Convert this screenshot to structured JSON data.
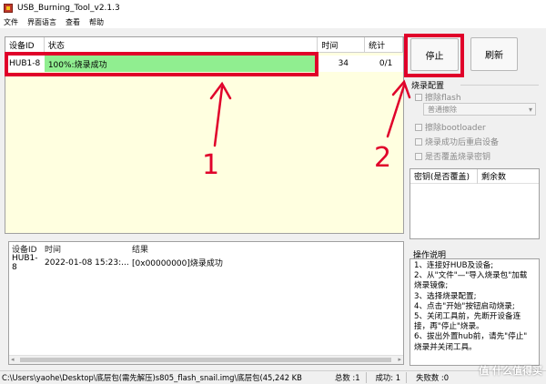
{
  "window": {
    "title": "USB_Burning_Tool_v2.1.3"
  },
  "menu": [
    "文件",
    "界面语言",
    "查看",
    "帮助"
  ],
  "table": {
    "headers": [
      "设备ID",
      "状态",
      "时间",
      "统计"
    ],
    "row": {
      "id": "HUB1-8",
      "status": "100%:烧录成功",
      "time": "34",
      "count": "0/1"
    }
  },
  "buttons": {
    "stop": "停止",
    "refresh": "刷新"
  },
  "config": {
    "title": "烧录配置",
    "erase_flash": "擦除flash",
    "erase_mode": "普通擦除",
    "erase_bootloader": "擦除bootloader",
    "reboot_after": "烧录成功后重启设备",
    "overwrite_key": "是否覆盖烧录密钥"
  },
  "key_table": {
    "col1": "密钥(是否覆盖)",
    "col2": "剩余数"
  },
  "log": {
    "headers": [
      "设备ID",
      "时间",
      "结果"
    ],
    "row": {
      "id": "HUB1-8",
      "time": "2022-01-08 15:23:...",
      "result": "[0x00000000]烧录成功"
    }
  },
  "instructions": {
    "title": "操作说明",
    "lines": [
      "1、连接好HUB及设备;",
      "2、从\"文件\"—\"导入烧录包\"加载",
      "烧录镜像;",
      "3、选择烧录配置;",
      "4、点击\"开始\"按钮启动烧录;",
      "5、关闭工具前，先断开设备连",
      "接，再\"停止\"烧录。",
      "6、拔出外置hub前，请先\"停止\"",
      "烧录并关闭工具。"
    ]
  },
  "statusbar": {
    "path": "C:\\Users\\yaohe\\Desktop\\底层包(需先解压)s805_flash_snail.img\\底层包(45,242 KB",
    "total": "总数 :1",
    "success": "成功: 1",
    "fail": "失败数 :0"
  },
  "annotations": {
    "one": "1",
    "two": "2"
  },
  "watermark": "值 什么值得买",
  "colors": {
    "accent_red": "#e0002a",
    "success_green": "#90ee90",
    "table_bg": "#ffffe0"
  }
}
